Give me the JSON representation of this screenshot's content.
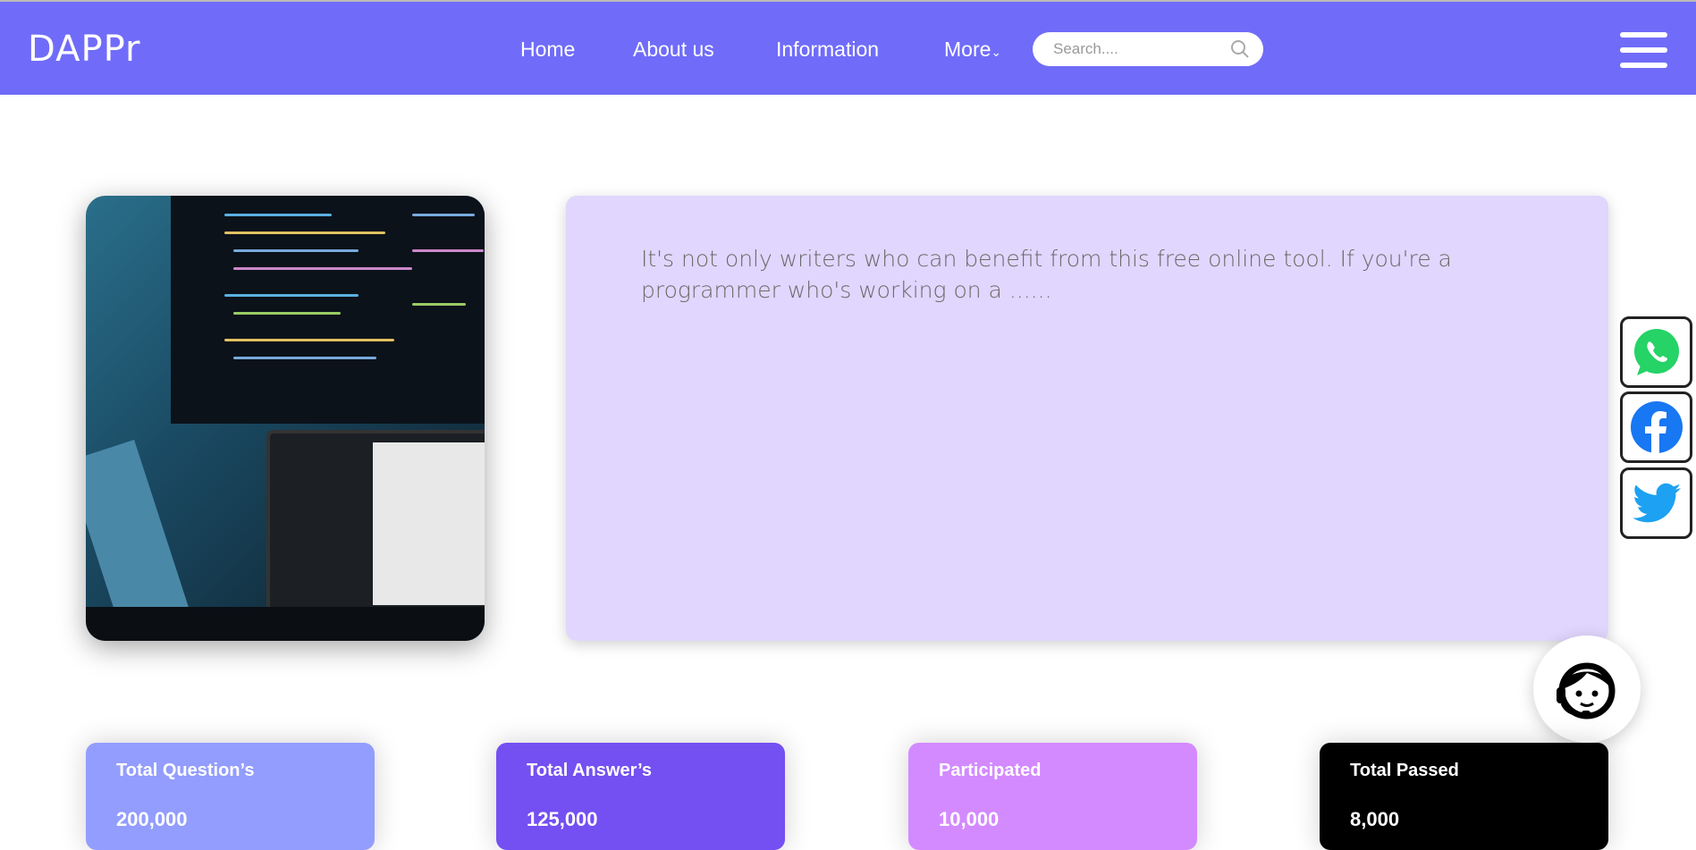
{
  "header": {
    "logo": "DAPPr",
    "nav": [
      "Home",
      "About us",
      "Information",
      "More"
    ],
    "search_placeholder": "Search...."
  },
  "hero": {
    "text": "It's not only writers who can benefit from this free online tool. If you're a programmer who's working on a ......"
  },
  "social": [
    "whatsapp",
    "facebook",
    "twitter"
  ],
  "stats": [
    {
      "title": "Total Question’s",
      "value": "200,000",
      "color": "#939dfd"
    },
    {
      "title": "Total Answer’s",
      "value": "125,000",
      "color": "#744ff2"
    },
    {
      "title": "Participated",
      "value": "10,000",
      "color": "#d38aff"
    },
    {
      "title": "Total Passed",
      "value": "8,000",
      "color": "#000000"
    }
  ]
}
